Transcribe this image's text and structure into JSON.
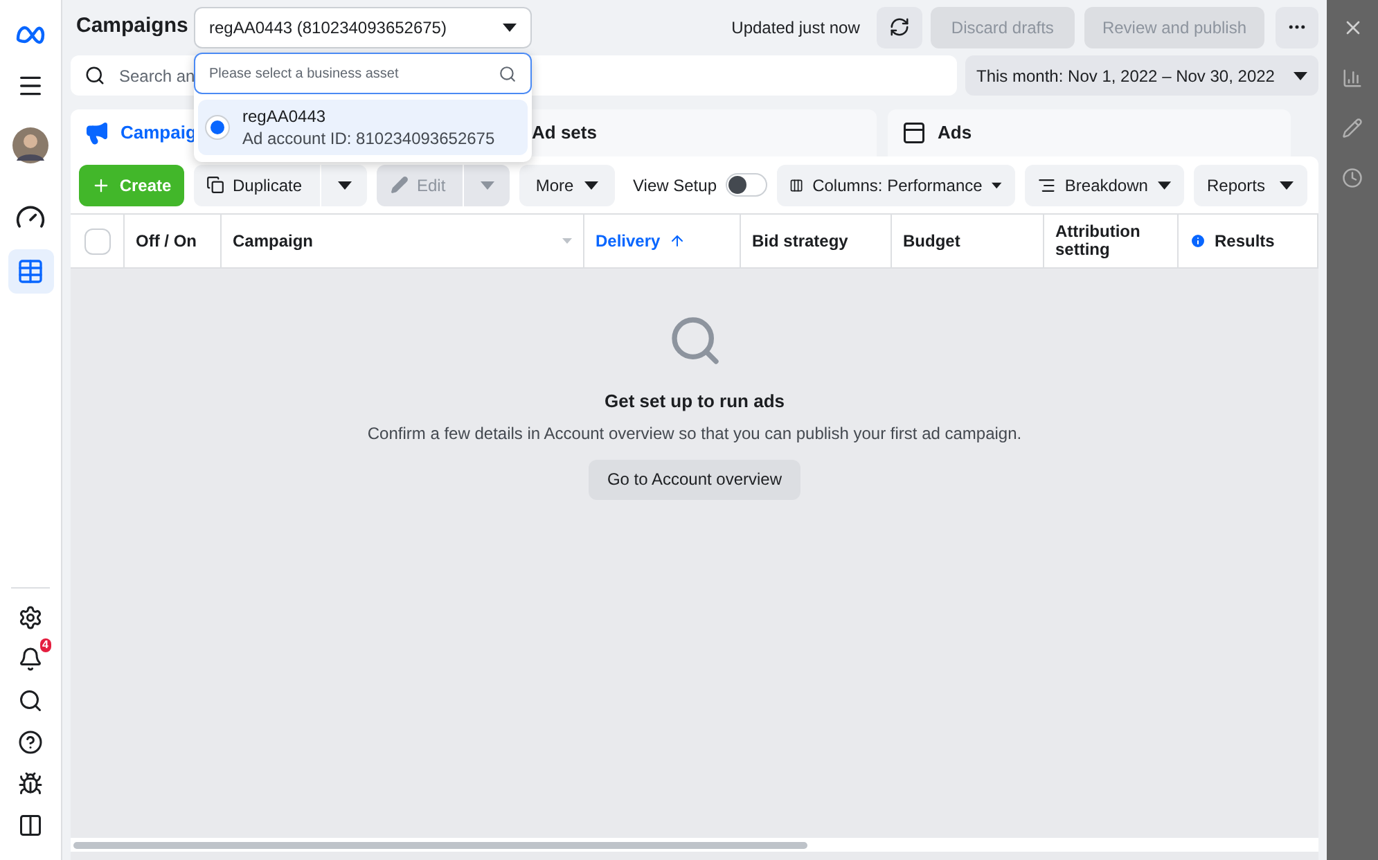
{
  "header": {
    "title": "Campaigns",
    "account_select": "regAA0443 (810234093652675)",
    "updated": "Updated just now",
    "discard": {
      "label": "Discard drafts",
      "disabled": true
    },
    "publish": {
      "label": "Review and publish",
      "disabled": true
    }
  },
  "dropdown": {
    "placeholder": "Please select a business asset",
    "options": [
      {
        "name": "regAA0443",
        "detail": "Ad account ID: 810234093652675",
        "selected": true
      }
    ]
  },
  "search": {
    "placeholder": "Search an"
  },
  "date_range": "This month: Nov 1, 2022 – Nov 30, 2022",
  "tabs": [
    {
      "label": "Campaig",
      "selected": true
    },
    {
      "label": "Ad sets",
      "selected": false
    },
    {
      "label": "Ads",
      "selected": false
    }
  ],
  "toolbar": {
    "create": "Create",
    "duplicate": {
      "label": "Duplicate",
      "disabled": false
    },
    "edit": {
      "label": "Edit",
      "disabled": true
    },
    "more": "More",
    "view_setup": {
      "label": "View Setup",
      "on": false
    },
    "columns": "Columns: Performance",
    "breakdown": "Breakdown",
    "reports": "Reports"
  },
  "table": {
    "select_all_checked": false,
    "columns": [
      {
        "label": "Off / On",
        "kind": "plain"
      },
      {
        "label": "Campaign",
        "kind": "filter"
      },
      {
        "label": "Delivery",
        "kind": "sorted"
      },
      {
        "label": "Bid strategy",
        "kind": "plain"
      },
      {
        "label": "Budget",
        "kind": "plain"
      },
      {
        "label": "Attribution setting",
        "kind": "plain"
      },
      {
        "label": "Results",
        "kind": "info"
      }
    ]
  },
  "empty_state": {
    "title": "Get set up to run ads",
    "message": "Confirm a few details in Account overview so that you can publish your first ad campaign.",
    "button": "Go to Account overview"
  },
  "notifications_badge": "4"
}
